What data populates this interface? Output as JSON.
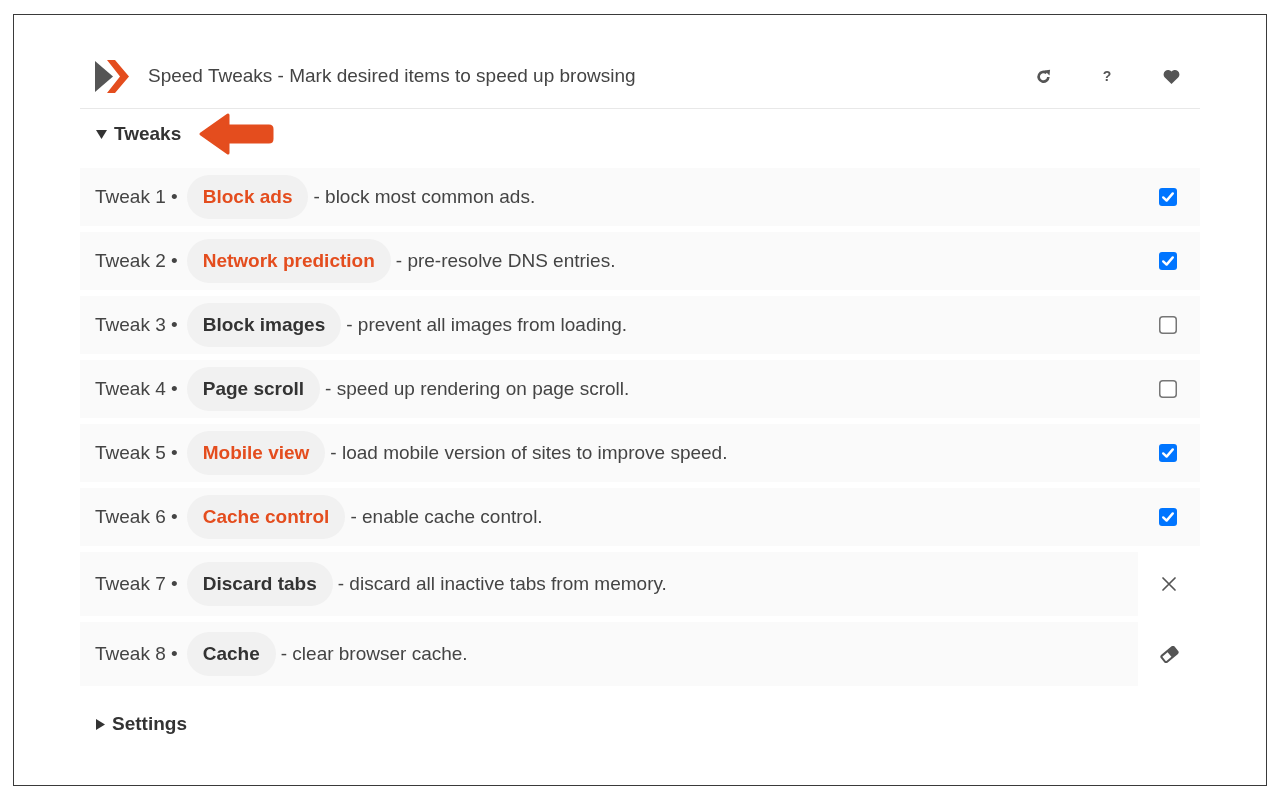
{
  "header": {
    "title": "Speed Tweaks - Mark desired items to speed up browsing",
    "help_label": "?"
  },
  "sections": [
    {
      "title": "Tweaks",
      "expanded": true,
      "annotated": true,
      "tweaks": [
        {
          "label": "Tweak 1 •",
          "name": "Block ads",
          "description": "- block most common ads.",
          "kind": "checkbox",
          "checked": true
        },
        {
          "label": "Tweak 2 •",
          "name": "Network prediction",
          "description": "- pre-resolve DNS entries.",
          "kind": "checkbox",
          "checked": true
        },
        {
          "label": "Tweak 3 •",
          "name": "Block images",
          "description": "- prevent all images from loading.",
          "kind": "checkbox",
          "checked": false
        },
        {
          "label": "Tweak 4 •",
          "name": "Page scroll",
          "description": "- speed up rendering on page scroll.",
          "kind": "checkbox",
          "checked": false
        },
        {
          "label": "Tweak 5 •",
          "name": "Mobile view",
          "description": "- load mobile version of sites to improve speed.",
          "kind": "checkbox",
          "checked": true
        },
        {
          "label": "Tweak 6 •",
          "name": "Cache control",
          "description": "- enable cache control.",
          "kind": "checkbox",
          "checked": true
        },
        {
          "label": "Tweak 7 •",
          "name": "Discard tabs",
          "description": "- discard all inactive tabs from memory.",
          "kind": "discard"
        },
        {
          "label": "Tweak 8 •",
          "name": "Cache",
          "description": "- clear browser cache.",
          "kind": "clear"
        }
      ]
    },
    {
      "title": "Settings",
      "expanded": false,
      "annotated": false
    }
  ]
}
